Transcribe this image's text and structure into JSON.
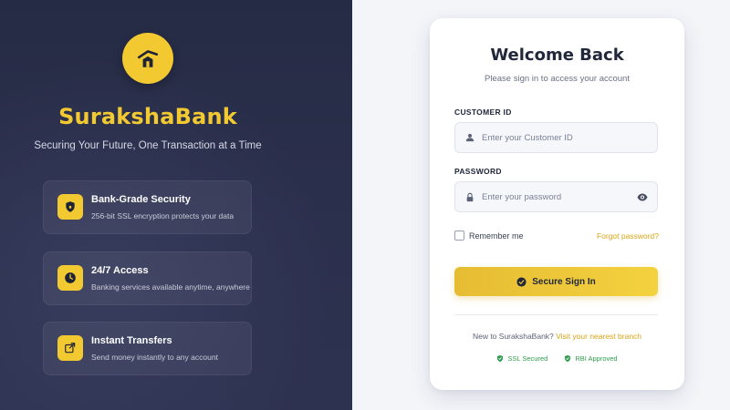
{
  "brand": {
    "name": "SurakshaBank",
    "tagline": "Securing Your Future, One Transaction at a Time",
    "accent_color": "#f3c932",
    "logo_icon": "house-icon"
  },
  "features": [
    {
      "icon": "shield-icon",
      "title": "Bank-Grade Security",
      "description": "256-bit SSL encryption protects your data"
    },
    {
      "icon": "clock-icon",
      "title": "24/7 Access",
      "description": "Banking services available anytime, anywhere"
    },
    {
      "icon": "transfer-icon",
      "title": "Instant Transfers",
      "description": "Send money instantly to any account"
    }
  ],
  "login": {
    "title": "Welcome Back",
    "subtitle": "Please sign in to access your account",
    "customer_id_label": "CUSTOMER ID",
    "customer_id_placeholder": "Enter your Customer ID",
    "customer_id_value": "",
    "password_label": "PASSWORD",
    "password_placeholder": "Enter your password",
    "password_value": "",
    "remember_label": "Remember me",
    "remember_checked": false,
    "forgot_label": "Forgot password?",
    "signin_label": "Secure Sign In",
    "new_to_text": "New to SurakshaBank?",
    "new_to_link": "Visit your nearest branch",
    "badges": [
      {
        "icon": "shield-check-icon",
        "label": "SSL Secured"
      },
      {
        "icon": "shield-check-icon",
        "label": "RBI Approved"
      }
    ],
    "badge_color": "#2f9e4e"
  }
}
